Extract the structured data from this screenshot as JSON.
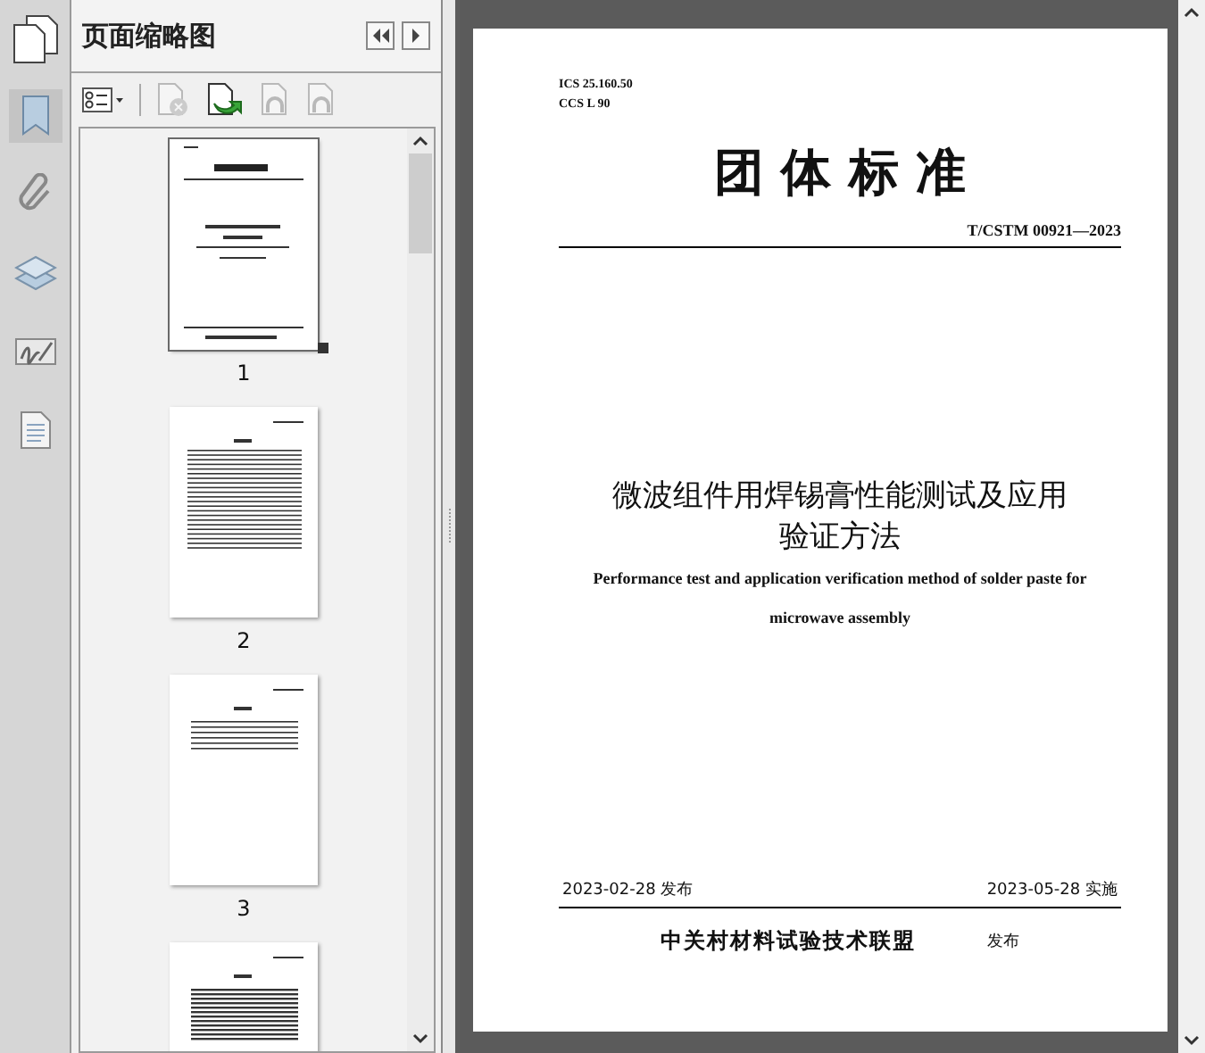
{
  "rail": [
    {
      "kind": "bookmark",
      "selected": true
    },
    {
      "kind": "attachment",
      "selected": false
    },
    {
      "kind": "layers",
      "selected": false
    },
    {
      "kind": "signature",
      "selected": false
    },
    {
      "kind": "document",
      "selected": false
    }
  ],
  "panel": {
    "title": "页面缩略图"
  },
  "toolbar": [
    {
      "kind": "options",
      "disabled": false
    },
    {
      "kind": "delete",
      "disabled": true
    },
    {
      "kind": "insert",
      "disabled": false
    },
    {
      "kind": "rotate",
      "disabled": true
    },
    {
      "kind": "rotate",
      "disabled": true
    }
  ],
  "thumbnails": [
    {
      "kind": "cover",
      "label": "1",
      "selected": true
    },
    {
      "kind": "contents",
      "label": "2",
      "selected": false
    },
    {
      "kind": "text",
      "label": "3",
      "selected": false
    },
    {
      "kind": "dense",
      "selected": false
    }
  ],
  "page": {
    "ics": "ICS 25.160.50",
    "ccs": "CCS L 90",
    "heading": "团 体 标 准",
    "code": "T/CSTM 00921—2023",
    "title_lines": [
      "微波组件用焊锡膏性能测试及应用",
      "验证方法"
    ],
    "english_lines": [
      "Performance test and application verification method of solder paste for",
      "microwave assembly"
    ],
    "issued": "2023-02-28 发布",
    "effective": "2023-05-28 实施",
    "publisher": "中关村材料试验技术联盟",
    "publish_label": "发布"
  }
}
